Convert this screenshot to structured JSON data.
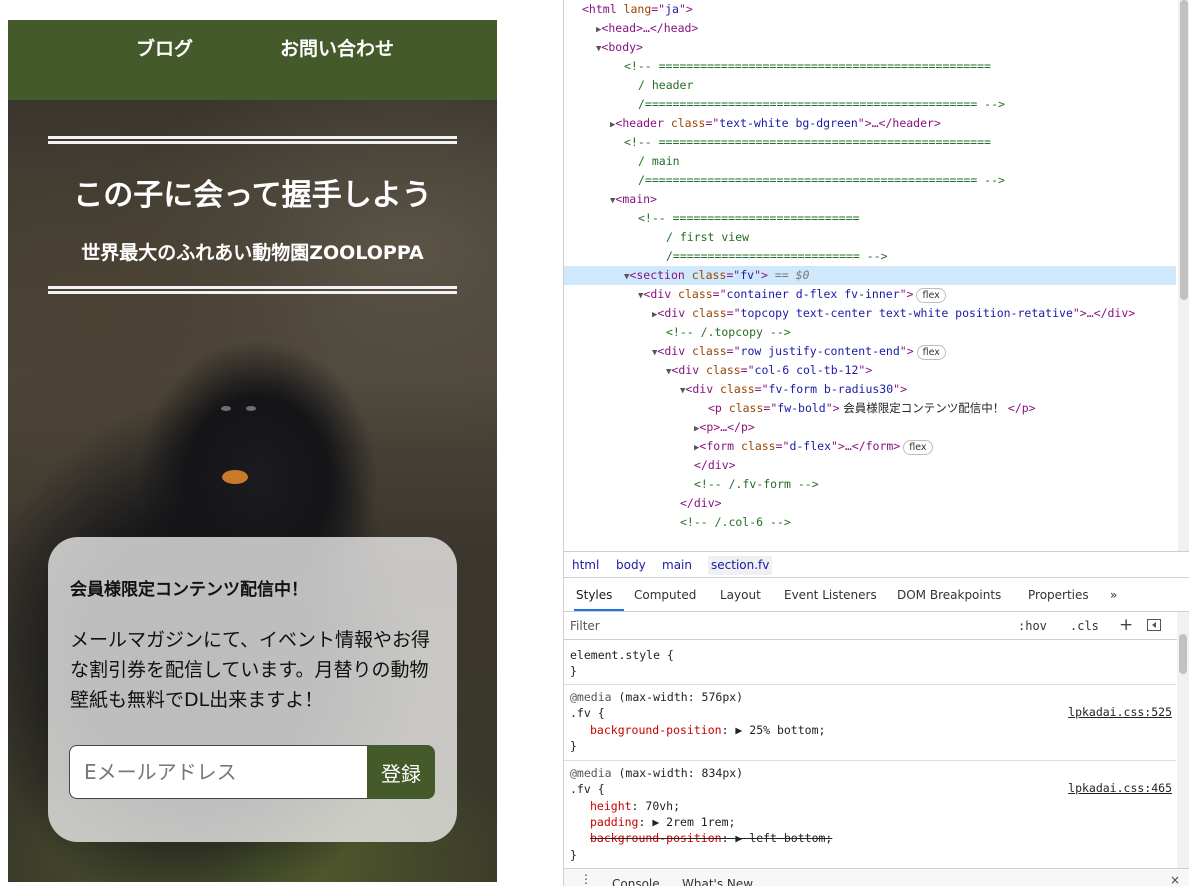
{
  "site": {
    "nav": {
      "blog": "ブログ",
      "contact": "お問い合わせ"
    },
    "hero": {
      "title": "この子に会って握手しよう",
      "subtitle": "世界最大のふれあい動物園ZOOLOPPA"
    },
    "form": {
      "heading": "会員様限定コンテンツ配信中！",
      "description": "メールマガジンにて、イベント情報やお得な割引券を配信しています。月替りの動物壁紙も無料でDL出来ますよ！",
      "email_placeholder": "Eメールアドレス",
      "submit_label": "登録"
    }
  },
  "devtools": {
    "elements": {
      "lines": [
        {
          "indent": 1,
          "arrow": "",
          "parts": [
            [
              "tg",
              "<html "
            ],
            [
              "at",
              "lang"
            ],
            [
              "tg",
              "=\""
            ],
            [
              "av",
              "ja"
            ],
            [
              "tg",
              "\">"
            ]
          ]
        },
        {
          "indent": 2,
          "arrow": "▶",
          "parts": [
            [
              "tg",
              "<head>…</head>"
            ]
          ]
        },
        {
          "indent": 2,
          "arrow": "▼",
          "parts": [
            [
              "tg",
              "<body>"
            ]
          ]
        },
        {
          "indent": 4,
          "arrow": "",
          "parts": [
            [
              "cm",
              "<!-- ================================================"
            ]
          ]
        },
        {
          "indent": 5,
          "arrow": "",
          "parts": [
            [
              "cm",
              "/ header"
            ]
          ]
        },
        {
          "indent": 5,
          "arrow": "",
          "parts": [
            [
              "cm",
              "/================================================ -->"
            ]
          ]
        },
        {
          "indent": 3,
          "arrow": "▶",
          "parts": [
            [
              "tg",
              "<header "
            ],
            [
              "at",
              "class"
            ],
            [
              "tg",
              "=\""
            ],
            [
              "av",
              "text-white bg-dgreen"
            ],
            [
              "tg",
              "\">…</header>"
            ]
          ]
        },
        {
          "indent": 4,
          "arrow": "",
          "parts": [
            [
              "cm",
              "<!-- ================================================"
            ]
          ]
        },
        {
          "indent": 5,
          "arrow": "",
          "parts": [
            [
              "cm",
              "/ main"
            ]
          ]
        },
        {
          "indent": 5,
          "arrow": "",
          "parts": [
            [
              "cm",
              "/================================================ -->"
            ]
          ]
        },
        {
          "indent": 3,
          "arrow": "▼",
          "parts": [
            [
              "tg",
              "<main>"
            ]
          ]
        },
        {
          "indent": 5,
          "arrow": "",
          "parts": [
            [
              "cm",
              "<!-- ==========================="
            ]
          ]
        },
        {
          "indent": 7,
          "arrow": "",
          "parts": [
            [
              "cm",
              "/ first view"
            ]
          ]
        },
        {
          "indent": 7,
          "arrow": "",
          "parts": [
            [
              "cm",
              "/=========================== -->"
            ]
          ]
        },
        {
          "indent": 4,
          "arrow": "▼",
          "selected": true,
          "parts": [
            [
              "tg",
              "<section "
            ],
            [
              "at",
              "class"
            ],
            [
              "tg",
              "=\""
            ],
            [
              "av",
              "fv"
            ],
            [
              "tg",
              "\">"
            ],
            [
              "dollar",
              " == $0"
            ]
          ]
        },
        {
          "indent": 5,
          "arrow": "▼",
          "badge": "flex",
          "parts": [
            [
              "tg",
              "<div "
            ],
            [
              "at",
              "class"
            ],
            [
              "tg",
              "=\""
            ],
            [
              "av",
              "container d-flex fv-inner"
            ],
            [
              "tg",
              "\">"
            ]
          ]
        },
        {
          "indent": 6,
          "arrow": "▶",
          "parts": [
            [
              "tg",
              "<div "
            ],
            [
              "at",
              "class"
            ],
            [
              "tg",
              "=\""
            ],
            [
              "av",
              "topcopy text-center text-white position-retative"
            ],
            [
              "tg",
              "\">…</div>"
            ]
          ]
        },
        {
          "indent": 7,
          "arrow": "",
          "parts": [
            [
              "cm",
              "<!-- /.topcopy -->"
            ]
          ]
        },
        {
          "indent": 6,
          "arrow": "▼",
          "badge": "flex",
          "parts": [
            [
              "tg",
              "<div "
            ],
            [
              "at",
              "class"
            ],
            [
              "tg",
              "=\""
            ],
            [
              "av",
              "row justify-content-end"
            ],
            [
              "tg",
              "\">"
            ]
          ]
        },
        {
          "indent": 7,
          "arrow": "▼",
          "parts": [
            [
              "tg",
              "<div "
            ],
            [
              "at",
              "class"
            ],
            [
              "tg",
              "=\""
            ],
            [
              "av",
              "col-6 col-tb-12"
            ],
            [
              "tg",
              "\">"
            ]
          ]
        },
        {
          "indent": 8,
          "arrow": "▼",
          "parts": [
            [
              "tg",
              "<div "
            ],
            [
              "at",
              "class"
            ],
            [
              "tg",
              "=\""
            ],
            [
              "av",
              "fv-form b-radius30"
            ],
            [
              "tg",
              "\">"
            ]
          ]
        },
        {
          "indent": 10,
          "arrow": "",
          "parts": [
            [
              "tg",
              "<p "
            ],
            [
              "at",
              "class"
            ],
            [
              "tg",
              "=\""
            ],
            [
              "av",
              "fw-bold"
            ],
            [
              "tg",
              "\">"
            ],
            [
              "tx",
              " 会員様限定コンテンツ配信中！ "
            ],
            [
              "tg",
              "</p>"
            ]
          ]
        },
        {
          "indent": 9,
          "arrow": "▶",
          "parts": [
            [
              "tg",
              "<p>…</p>"
            ]
          ]
        },
        {
          "indent": 9,
          "arrow": "▶",
          "badge": "flex",
          "parts": [
            [
              "tg",
              "<form "
            ],
            [
              "at",
              "class"
            ],
            [
              "tg",
              "=\""
            ],
            [
              "av",
              "d-flex"
            ],
            [
              "tg",
              "\">…</form>"
            ]
          ]
        },
        {
          "indent": 9,
          "arrow": "",
          "parts": [
            [
              "tg",
              "</div>"
            ]
          ]
        },
        {
          "indent": 9,
          "arrow": "",
          "parts": [
            [
              "cm",
              "<!-- /.fv-form -->"
            ]
          ]
        },
        {
          "indent": 8,
          "arrow": "",
          "parts": [
            [
              "tg",
              "</div>"
            ]
          ]
        },
        {
          "indent": 8,
          "arrow": "",
          "parts": [
            [
              "cm",
              "<!-- /.col-6 -->"
            ]
          ]
        }
      ]
    },
    "breadcrumbs": [
      "html",
      "body",
      "main",
      "section.fv"
    ],
    "tabs": [
      "Styles",
      "Computed",
      "Layout",
      "Event Listeners",
      "DOM Breakpoints",
      "Properties",
      "»"
    ],
    "filter": {
      "placeholder": "Filter",
      "hov": ":hov",
      "cls": ".cls"
    },
    "styles": {
      "element_style": "element.style {",
      "close": "}",
      "rule1": {
        "media_kw": "@media",
        "media_q": " (max-width: 576px)",
        "selector": ".fv {",
        "source": "lpkadai.css:525",
        "prop": "background-position",
        "val": "▶ 25% bottom;"
      },
      "rule2": {
        "media_kw": "@media",
        "media_q": " (max-width: 834px)",
        "selector": ".fv {",
        "source": "lpkadai.css:465",
        "p1": "height",
        "v1": " 70vh;",
        "p2": "padding",
        "v2": "▶ 2rem 1rem;",
        "p3": "background-position",
        "v3": "▶ left bottom;"
      }
    },
    "drawer": {
      "console": "Console",
      "whats_new": "What's New",
      "close": "×"
    },
    "colors": {
      "site_green": "#445a2b",
      "selected_row": "#cfe8fc",
      "tag": "#881280",
      "attr": "#994500",
      "attr_value": "#1a1aa6",
      "comment": "#236e25"
    }
  }
}
